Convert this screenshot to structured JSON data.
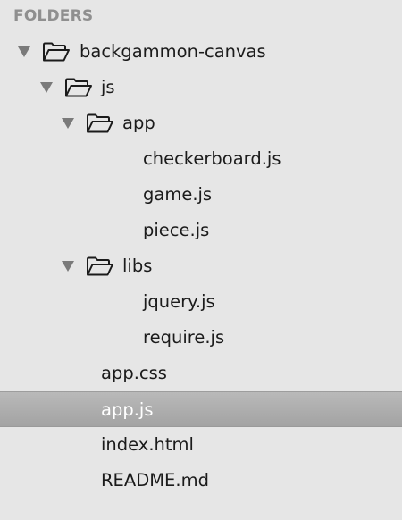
{
  "sidebar": {
    "header": "FOLDERS",
    "rows": [
      {
        "label": "backgammon-canvas",
        "kind": "folder",
        "expanded": true,
        "depth": 0,
        "selected": false
      },
      {
        "label": "js",
        "kind": "folder",
        "expanded": true,
        "depth": 1,
        "selected": false
      },
      {
        "label": "app",
        "kind": "folder",
        "expanded": true,
        "depth": 2,
        "selected": false
      },
      {
        "label": "checkerboard.js",
        "kind": "file",
        "depth": 3,
        "selected": false
      },
      {
        "label": "game.js",
        "kind": "file",
        "depth": 3,
        "selected": false
      },
      {
        "label": "piece.js",
        "kind": "file",
        "depth": 3,
        "selected": false
      },
      {
        "label": "libs",
        "kind": "folder",
        "expanded": true,
        "depth": 2,
        "selected": false
      },
      {
        "label": "jquery.js",
        "kind": "file",
        "depth": 3,
        "selected": false
      },
      {
        "label": "require.js",
        "kind": "file",
        "depth": 3,
        "selected": false
      },
      {
        "label": "app.css",
        "kind": "file",
        "depth": 1,
        "selected": false
      },
      {
        "label": "app.js",
        "kind": "file",
        "depth": 1,
        "selected": true
      },
      {
        "label": "index.html",
        "kind": "file",
        "depth": 1,
        "selected": false
      },
      {
        "label": "README.md",
        "kind": "file",
        "depth": 1,
        "selected": false
      }
    ],
    "icons": {
      "expand": "disclosure-triangle-down-icon",
      "folder": "folder-open-icon"
    },
    "colors": {
      "background": "#e6e6e6",
      "header_text": "#8f8f8f",
      "selected_row": "#a9a9a9",
      "selected_text": "#ffffff"
    }
  }
}
